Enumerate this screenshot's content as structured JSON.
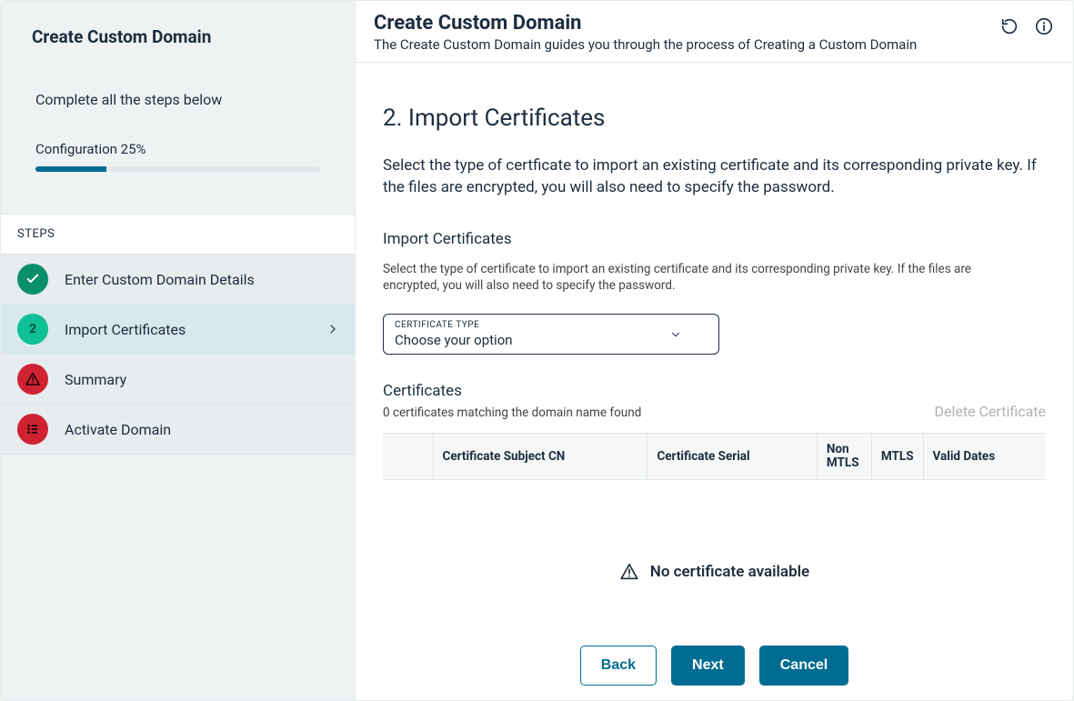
{
  "sidebar": {
    "title": "Create Custom Domain",
    "instruction": "Complete all the steps below",
    "progress_label": "Configuration 25%",
    "progress_percent": 25,
    "steps_header": "STEPS",
    "steps": [
      {
        "label": "Enter Custom Domain Details",
        "state": "done"
      },
      {
        "label": "Import Certificates",
        "state": "current"
      },
      {
        "label": "Summary",
        "state": "pending"
      },
      {
        "label": "Activate Domain",
        "state": "pending"
      }
    ]
  },
  "header": {
    "title": "Create Custom Domain",
    "subtitle": "The Create Custom Domain guides you through the process of Creating a Custom Domain"
  },
  "main": {
    "heading": "2. Import Certificates",
    "description": "Select the type of certficate to import an existing certificate and its corresponding private key. If the files are encrypted, you will also need to specify the password.",
    "import_block": {
      "title": "Import Certificates",
      "description": "Select the type of certificate to import an existing certificate and its corresponding private key. If the files are encrypted, you will also need to specify the password.",
      "select_label": "CERTIFICATE TYPE",
      "select_value": "Choose your option"
    },
    "certs": {
      "title": "Certificates",
      "count_text": "0 certificates matching the domain name found",
      "delete_label": "Delete Certificate",
      "columns": [
        "",
        "Certificate Subject CN",
        "Certificate Serial",
        "Non MTLS",
        "MTLS",
        "Valid Dates"
      ],
      "empty_text": "No certificate available"
    }
  },
  "footer": {
    "back": "Back",
    "next": "Next",
    "cancel": "Cancel"
  },
  "colors": {
    "accent": "#006c91",
    "green": "#0a8f6b",
    "green_light": "#0fbf95",
    "red": "#cf2333"
  }
}
